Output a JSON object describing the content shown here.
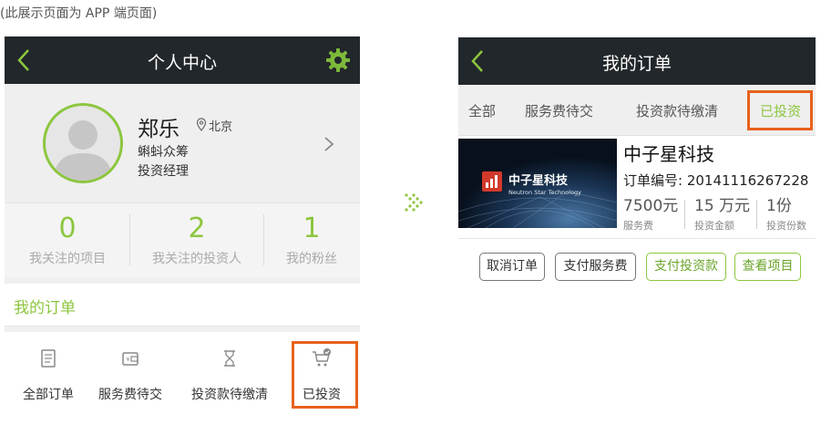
{
  "note": "(此展示页面为 APP 端页面)",
  "colors": {
    "accent": "#8cc63f",
    "highlight": "#e8611c",
    "topbar": "#22272b"
  },
  "profile_page": {
    "title": "个人中心",
    "user": {
      "name": "郑乐",
      "location": "北京",
      "org": "蝌蚪众筹",
      "role": "投资经理"
    },
    "stats": [
      {
        "count": "0",
        "label": "我关注的项目"
      },
      {
        "count": "2",
        "label": "我关注的投资人"
      },
      {
        "count": "1",
        "label": "我的粉丝"
      }
    ],
    "orders_title": "我的订单",
    "order_tabs": [
      {
        "label": "全部订单",
        "icon": "document-icon"
      },
      {
        "label": "服务费待交",
        "icon": "wallet-icon"
      },
      {
        "label": "投资款待缴清",
        "icon": "hourglass-icon"
      },
      {
        "label": "已投资",
        "icon": "cart-check-icon"
      }
    ]
  },
  "orders_page": {
    "title": "我的订单",
    "tabs": [
      "全部",
      "服务费待交",
      "投资款待缴清",
      "已投资"
    ],
    "active_tab": "已投资",
    "order": {
      "company": "中子星科技",
      "banner_cn": "中子星科技",
      "banner_en": "Neutron Star Technology",
      "order_no": "订单编号: 20141116267228",
      "meta": [
        {
          "value": "7500元",
          "label": "服务费"
        },
        {
          "value": "15 万元",
          "label": "投资金额"
        },
        {
          "value": "1份",
          "label": "投资份数"
        }
      ],
      "actions": [
        "取消订单",
        "支付服务费",
        "支付投资款",
        "查看项目"
      ]
    }
  }
}
